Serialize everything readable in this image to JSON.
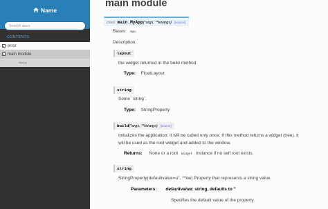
{
  "sidebar": {
    "project_name": "Name",
    "search_placeholder": "Search docs",
    "caption": "CONTENTS:",
    "items": [
      {
        "label": "error"
      },
      {
        "label": "main module"
      },
      {
        "label": "MyApp"
      }
    ]
  },
  "page": {
    "title": "main module",
    "class_sig": {
      "keyword": "class",
      "name": "main.MyApp",
      "args": "(*args, **kwargs)",
      "source": "[source]"
    },
    "bases_label": "Bases:",
    "bases_value": "App",
    "description": "Description.",
    "layout": {
      "name": "layout",
      "desc": "the widget returned in the build method",
      "type_label": "Type:",
      "type_value": "FloatLayout"
    },
    "string1": {
      "name": "string",
      "desc": "Some `string`.",
      "type_label": "Type:",
      "type_value": "StringProperty"
    },
    "build": {
      "name": "build",
      "args": "(*args, **kwargs)",
      "source": "[source]",
      "desc1": "Initializes the application; it will be called only once. If this method returns a widget (tree), it",
      "desc2": "will be used as the root widget and added to the window.",
      "returns_label": "Returns:",
      "returns_pre": "None or a root",
      "returns_code": "Widget",
      "returns_post": "instance if no self.root exists."
    },
    "string2": {
      "name": "string",
      "desc": "StringProperty(defaultvalue=u'', **kw) Property that represents a string value.",
      "params_label": "Parameters:",
      "param_name": "defaultvalue",
      "param_type": ": string, defaults to ''",
      "param_desc": "Specifies the default value of the property."
    }
  }
}
